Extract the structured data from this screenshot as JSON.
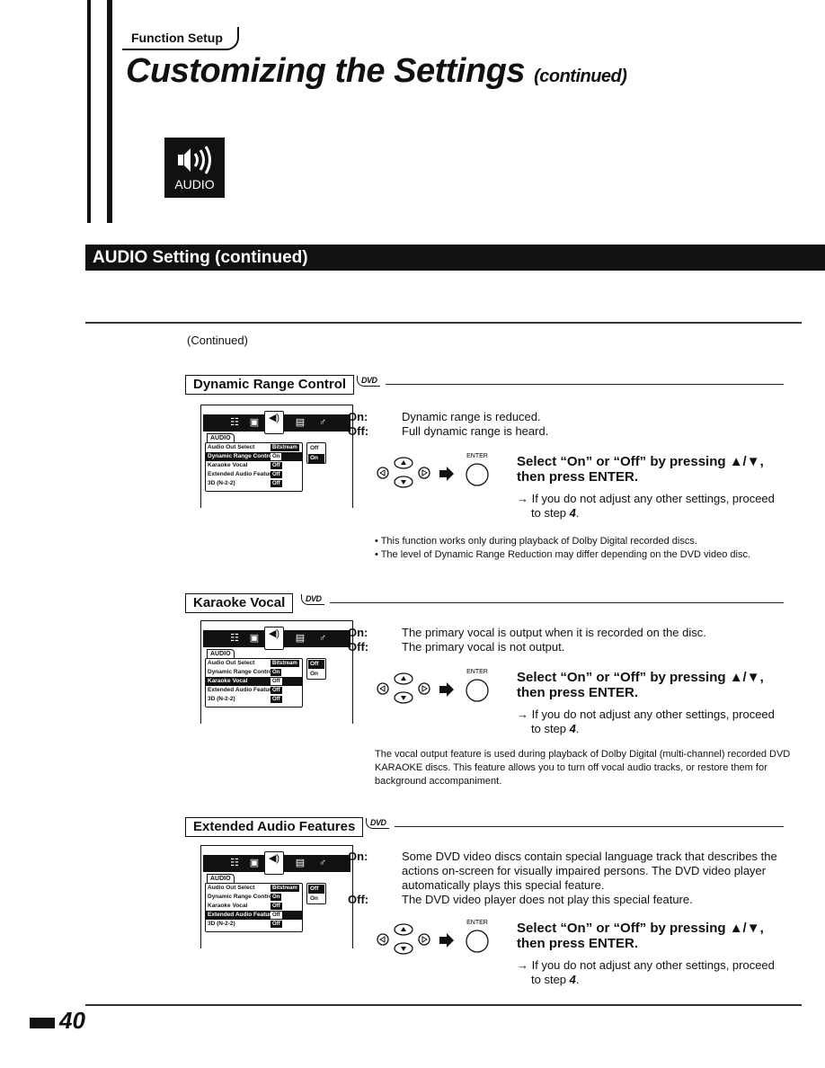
{
  "header": {
    "function_setup": "Function Setup",
    "title": "Customizing the Settings",
    "title_suffix": "(continued)"
  },
  "audio_icon": {
    "icon": "speaker-icon",
    "label": "AUDIO"
  },
  "section_banner": "AUDIO Setting (continued)",
  "continued_note": "(Continued)",
  "dvd_badge": "DVD",
  "menu": {
    "tab_label": "AUDIO",
    "top_icons": [
      "language-icon",
      "picture-icon",
      "audio-icon",
      "display-icon",
      "parental-lock-icon"
    ],
    "rows": [
      {
        "label": "Audio Out Select",
        "value": "Bitstream"
      },
      {
        "label": "Dynamic Range Control",
        "value": "On"
      },
      {
        "label": "Karaoke Vocal",
        "value": "Off"
      },
      {
        "label": "Extended Audio Features",
        "value": "Off"
      },
      {
        "label": "3D (N-2-2)",
        "value": "Off"
      }
    ],
    "options": [
      "Off",
      "On"
    ]
  },
  "remote": {
    "enter_label": "ENTER"
  },
  "sections": [
    {
      "title": "Dynamic Range Control",
      "highlight_row": 1,
      "selected_option": 1,
      "on_label": "On:",
      "on_text": "Dynamic range is reduced.",
      "off_label": "Off:",
      "off_text": "Full dynamic range is heard.",
      "instruction_line1": "Select “On” or “Off” by pressing ▲/▼,",
      "instruction_line2": "then press ENTER.",
      "step_note_prefix": "→ If you do not adjust any other settings, proceed to step ",
      "step_number": "4",
      "notes": [
        "• This function works only during playback of Dolby Digital recorded discs.",
        "• The level of Dynamic Range Reduction may differ depending on the DVD video disc."
      ]
    },
    {
      "title": "Karaoke Vocal",
      "highlight_row": 2,
      "selected_option": 0,
      "on_label": "On:",
      "on_text": "The primary vocal is output when it is recorded on the disc.",
      "off_label": "Off:",
      "off_text": "The primary vocal is not output.",
      "instruction_line1": "Select “On” or “Off” by pressing ▲/▼,",
      "instruction_line2": "then press ENTER.",
      "step_note_prefix": "→ If you do not adjust any other settings, proceed to step ",
      "step_number": "4",
      "notes": [
        "The vocal output feature is used during playback of Dolby Digital (multi-channel) recorded DVD KARAOKE discs. This feature allows you to turn off vocal audio tracks, or restore them for background accompaniment."
      ]
    },
    {
      "title": "Extended Audio Features",
      "highlight_row": 3,
      "selected_option": 0,
      "on_label": "On:",
      "on_text": "Some DVD video discs contain special language track that describes the actions on-screen for visually impaired persons. The DVD video player automatically plays this special feature.",
      "off_label": "Off:",
      "off_text": "The DVD video player does not play this special feature.",
      "instruction_line1": "Select “On” or “Off” by pressing ▲/▼,",
      "instruction_line2": "then press ENTER.",
      "step_note_prefix": "→ If you do not adjust any other settings, proceed to step ",
      "step_number": "4",
      "notes": []
    }
  ],
  "footer": {
    "page_number": "40"
  }
}
